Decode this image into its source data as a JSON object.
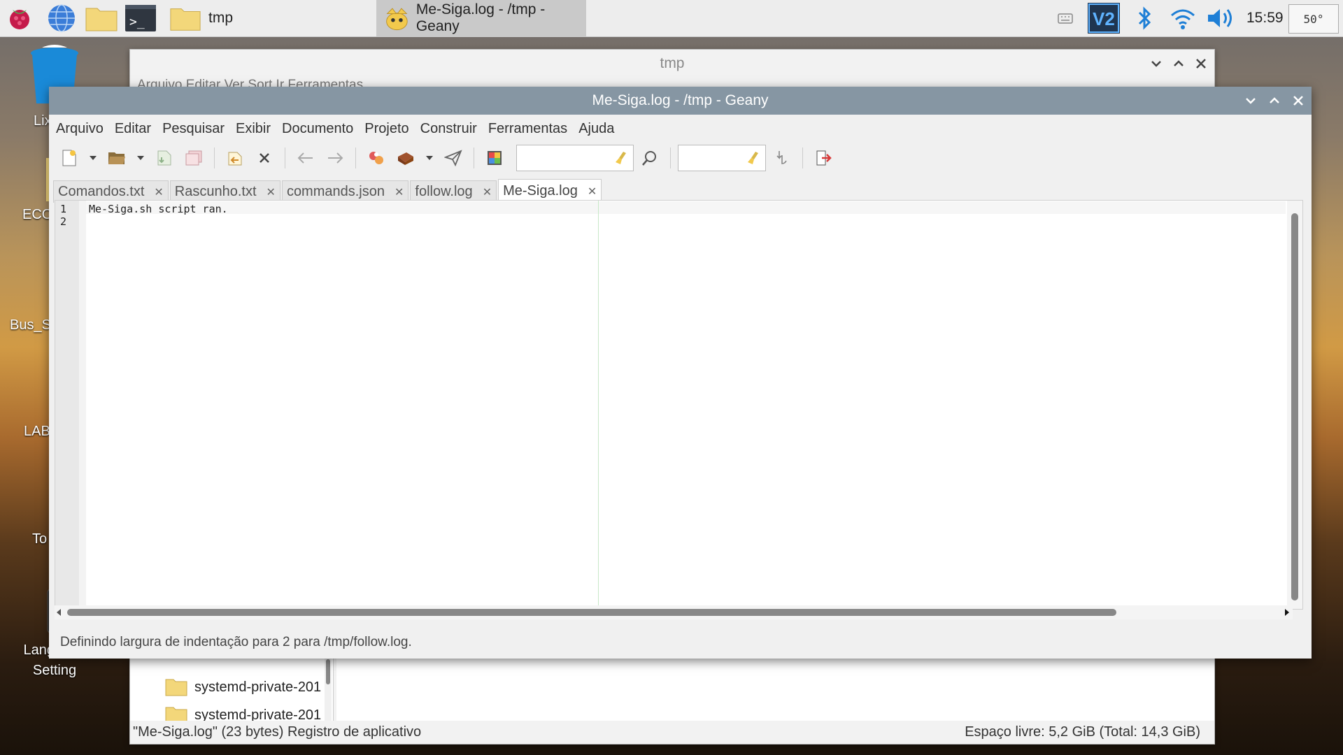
{
  "taskbar": {
    "tasks": [
      {
        "label": "tmp"
      },
      {
        "label": "Me-Siga.log - /tmp - Geany"
      }
    ],
    "clock": "15:59",
    "temperature": "50°"
  },
  "desktop_icons": [
    {
      "label": "Lix",
      "icon": "trash-icon"
    },
    {
      "label": "ECO",
      "icon": "folder-icon"
    },
    {
      "label": "Bus_S",
      "icon": "gear-icon"
    },
    {
      "label": "LAB",
      "icon": "gem-icon"
    },
    {
      "label": "To",
      "icon": "app-icon"
    },
    {
      "label": "Language Setting",
      "icon": "language-icon"
    }
  ],
  "file_manager": {
    "title": "tmp",
    "menu_partial": "Arquivo  Editar  Ver  Sort  Ir  Ferramentas",
    "folders": [
      {
        "name": "systemd-private-201"
      },
      {
        "name": "systemd-private-201"
      }
    ],
    "status_left": "\"Me-Siga.log\" (23 bytes) Registro de aplicativo",
    "status_right": "Espaço livre: 5,2 GiB (Total: 14,3 GiB)"
  },
  "geany": {
    "title": "Me-Siga.log - /tmp - Geany",
    "menu": [
      "Arquivo",
      "Editar",
      "Pesquisar",
      "Exibir",
      "Documento",
      "Projeto",
      "Construir",
      "Ferramentas",
      "Ajuda"
    ],
    "tabs": [
      {
        "label": "Comandos.txt"
      },
      {
        "label": "Rascunho.txt"
      },
      {
        "label": "commands.json"
      },
      {
        "label": "follow.log"
      },
      {
        "label": "Me-Siga.log"
      }
    ],
    "active_tab": "Me-Siga.log",
    "lines": [
      {
        "num": "1",
        "text": "Me-Siga.sh script ran."
      },
      {
        "num": "2",
        "text": ""
      }
    ],
    "status": "Definindo largura de indentação para 2 para /tmp/follow.log."
  },
  "colors": {
    "geany_titlebar": "#8696a3",
    "panel": "#ededed",
    "accent_blue": "#1e7fd6"
  }
}
